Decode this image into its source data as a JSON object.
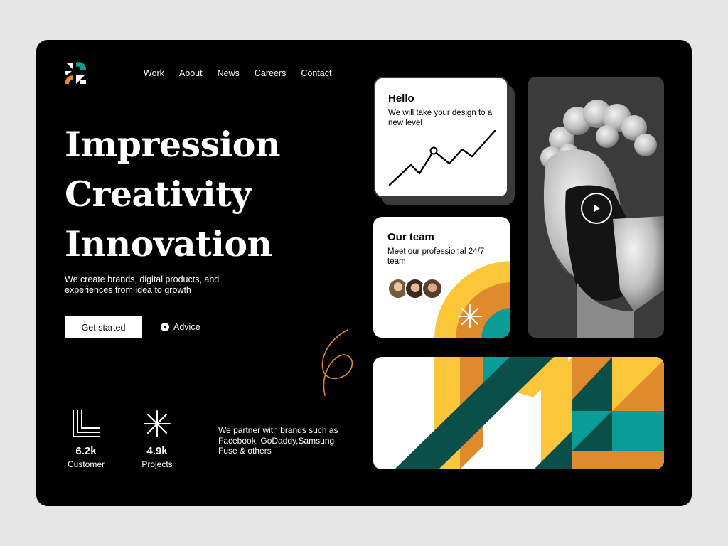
{
  "nav": {
    "items": [
      "Work",
      "About",
      "News",
      "Careers",
      "Contact"
    ]
  },
  "hero": {
    "line1": "Impression",
    "line2": "Creativity",
    "line3": "Innovation",
    "lead": "We create brands, digital products, and experiences from idea to growth",
    "cta_label": "Get started",
    "advice_label": "Advice"
  },
  "stats": [
    {
      "value": "6.2k",
      "label": "Customer",
      "icon": "stacked-lines-icon"
    },
    {
      "value": "4.9k",
      "label": "Projects",
      "icon": "asterisk-icon"
    }
  ],
  "partner_text": "We partner with brands such as Facebook, GoDaddy,Samsung Fuse & others",
  "card_hello": {
    "title": "Hello",
    "subtitle": "We will take your design to a new level"
  },
  "card_team": {
    "title": "Our team",
    "subtitle": "Meet our professional 24/7 team"
  },
  "colors": {
    "yellow": "#fcc63b",
    "orange": "#e08a2e",
    "teal": "#0a9c96",
    "dark_green": "#0b4f4a",
    "background": "#000000"
  }
}
